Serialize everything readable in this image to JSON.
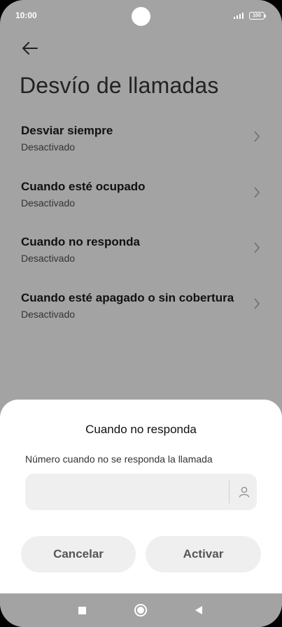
{
  "status_bar": {
    "time": "10:00",
    "battery": "100"
  },
  "page": {
    "title": "Desvío de llamadas"
  },
  "settings": [
    {
      "title": "Desviar siempre",
      "status": "Desactivado"
    },
    {
      "title": "Cuando esté ocupado",
      "status": "Desactivado"
    },
    {
      "title": "Cuando no responda",
      "status": "Desactivado"
    },
    {
      "title": "Cuando esté apagado o sin cobertura",
      "status": "Desactivado"
    }
  ],
  "dialog": {
    "title": "Cuando no responda",
    "field_label": "Número cuando no se responda la llamada",
    "input_value": "",
    "cancel_label": "Cancelar",
    "activate_label": "Activar"
  },
  "icons": {
    "back": "arrow-left-icon",
    "chevron": "chevron-right-icon",
    "contact": "person-icon",
    "nav_recents": "square-icon",
    "nav_home": "circle-icon",
    "nav_back": "triangle-left-icon"
  },
  "colors": {
    "dimmed_background": "#a3a3a3",
    "sheet_background": "#ffffff",
    "button_background": "#efefef"
  }
}
